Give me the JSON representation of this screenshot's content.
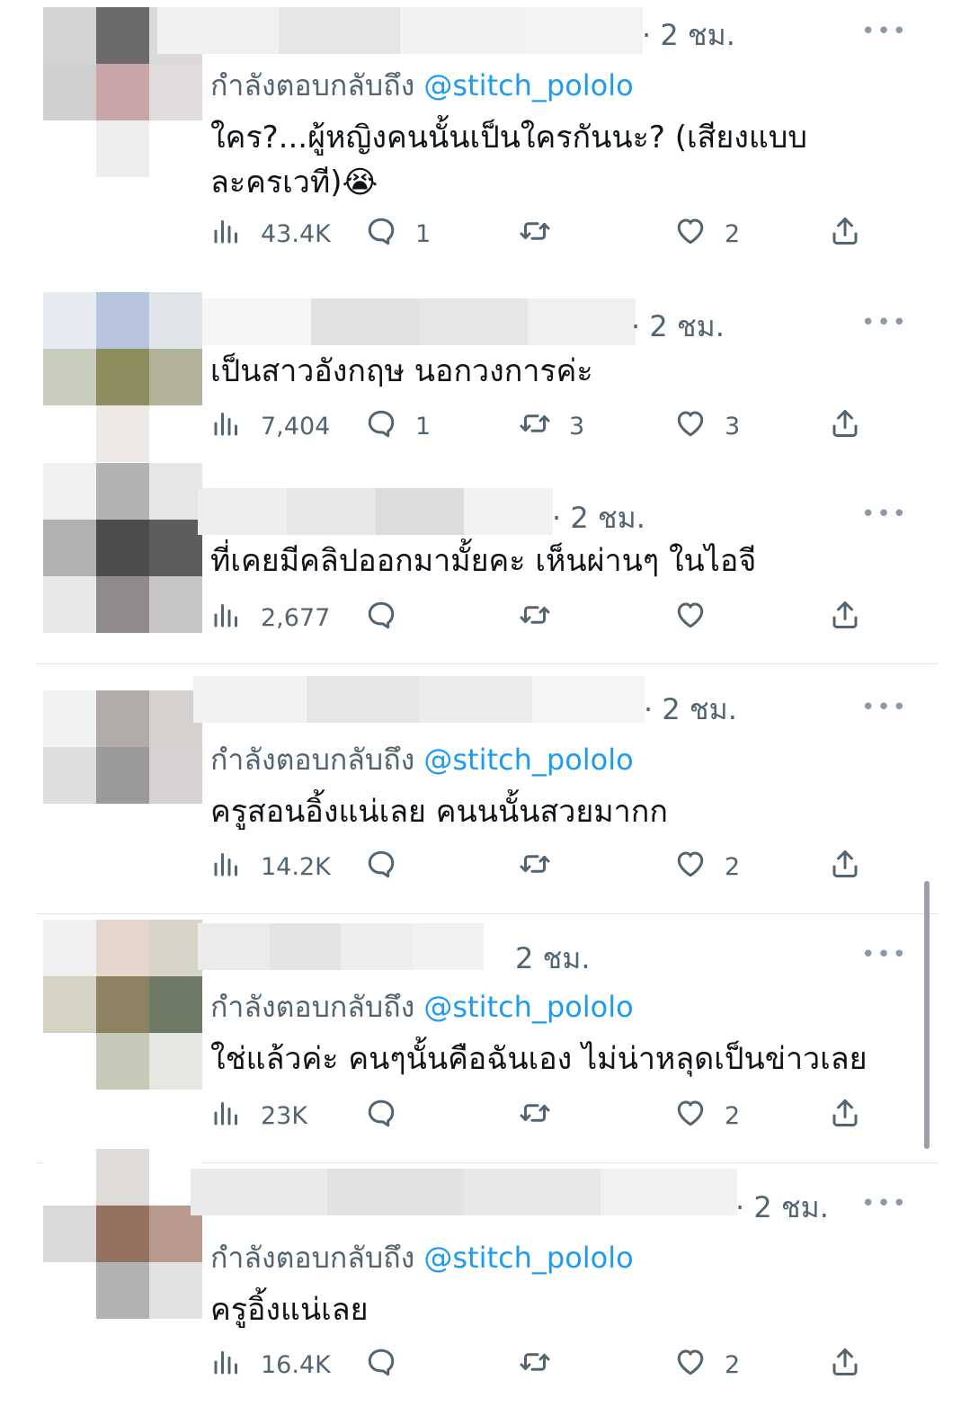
{
  "tweets": [
    {
      "time": "· 2 ชม.",
      "more": "•••",
      "replying_prefix": "กำลังตอบกลับถึง",
      "replying_handle": "@stitch_pololo",
      "text": "ใคร?...ผู้หญิงคนนั้นเป็นใครกันนะ? (เสียงแบบละครเวที)😭",
      "views": "43.4K",
      "replies": "1",
      "retweets": "",
      "likes": "2"
    },
    {
      "time": "· 2 ชม.",
      "more": "•••",
      "text": "เป็นสาวอังกฤษ นอกวงการค่ะ",
      "views": "7,404",
      "replies": "1",
      "retweets": "3",
      "likes": "3"
    },
    {
      "time": "· 2 ชม.",
      "more": "•••",
      "text": "ที่เคยมีคลิปออกมามั้ยคะ เห็นผ่านๆ ในไอจี",
      "views": "2,677",
      "replies": "",
      "retweets": "",
      "likes": ""
    },
    {
      "time": "· 2 ชม.",
      "more": "•••",
      "replying_prefix": "กำลังตอบกลับถึง",
      "replying_handle": "@stitch_pololo",
      "text": "ครูสอนอิ้งแน่เลย คนนนั้นสวยมากก",
      "views": "14.2K",
      "replies": "",
      "retweets": "",
      "likes": "2"
    },
    {
      "time": "2 ชม.",
      "more": "•••",
      "replying_prefix": "กำลังตอบกลับถึง",
      "replying_handle": "@stitch_pololo",
      "text": "ใช่แล้วค่ะ คนๆนั้นคือฉันเอง ไม่น่าหลุดเป็นข่าวเลย",
      "views": "23K",
      "replies": "",
      "retweets": "",
      "likes": "2"
    },
    {
      "time": "· 2 ชม.",
      "more": "•••",
      "replying_prefix": "กำลังตอบกลับถึง",
      "replying_handle": "@stitch_pololo",
      "text": "ครูอิ้งแน่เลย",
      "views": "16.4K",
      "replies": "",
      "retweets": "",
      "likes": "2"
    }
  ],
  "colors": {
    "secondary_text": "#536471",
    "link": "#1d9bf0",
    "primary_text": "#0f1419",
    "divider": "#dfe3e6"
  },
  "icons": [
    "views-icon",
    "reply-icon",
    "retweet-icon",
    "like-icon",
    "share-icon",
    "more-icon"
  ],
  "avatars": [
    [
      "#d3d3d3",
      "#6b6b6e",
      "#dadada",
      "#cfcfd0",
      "#c9a5a7",
      "#e0dcdc",
      "#ffffff",
      "#efedec",
      "#ffffff"
    ],
    [
      "#e6ebf2",
      "#b6c4dd",
      "#e1e5ea",
      "#c9cdbd",
      "#8e8d5e",
      "#b3b39c",
      "#ffffff",
      "#ece9e6",
      "#ffffff"
    ],
    [
      "#f0f0f0",
      "#b2b2b2",
      "#e6e6e6",
      "#b1b1b1",
      "#4d4b4b",
      "#5f5c5c",
      "#e8e8e8",
      "#8f8b8b",
      "#c7c5c5"
    ],
    [
      "#f2f2f2",
      "#b1aca8",
      "#d4d0cd",
      "#dddddd",
      "#9b9999",
      "#d6d2d2",
      "#ffffff",
      "#ffffff",
      "#ffffff"
    ],
    [
      "#f0f0f0",
      "#e5d7cc",
      "#d6d5c8",
      "#d4d3c3",
      "#8c8262",
      "#6f7a66",
      "#ffffff",
      "#c6c9b7",
      "#e6e6e2"
    ],
    [
      "#ffffff",
      "#dfdbd8",
      "#ffffff",
      "#d9d9d9",
      "#93705f",
      "#b79a8d",
      "#ffffff",
      "#b4b2b0",
      "#e4e2e1"
    ]
  ],
  "namebars": [
    [
      "#f0f0f0",
      "#e6e6e6",
      "#f2f2f2",
      "#f3f3f3"
    ],
    [
      "#f6f6f6",
      "#e1e1e1",
      "#e6e6e6",
      "#f0f0f0"
    ],
    [
      "#eeeeee",
      "#e7e7e7",
      "#dcdcdc",
      "#f2f2f2"
    ],
    [
      "#f2f2f2",
      "#e6e6e6",
      "#ececec",
      "#f5f5f5"
    ],
    [
      "#ebebeb",
      "#e4e4e4",
      "#eeeeee",
      "#f2f2f2"
    ],
    [
      "#eaeaea",
      "#e2e2e2",
      "#e8e8e8",
      "#f1f1f1"
    ]
  ]
}
